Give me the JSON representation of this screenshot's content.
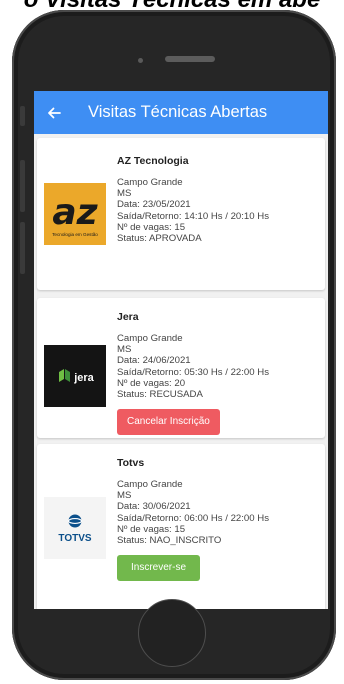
{
  "caption": "o Visitas Técnicas em abe",
  "header": {
    "title": "Visitas Técnicas Abertas",
    "back_icon": "arrow-left-icon",
    "color": "#3e8ef3"
  },
  "visits": [
    {
      "company": "AZ Tecnologia",
      "logo_icon": "az-tecnologia-logo",
      "logo_text": "az",
      "logo_subtext": "Tecnologia em Gestão",
      "city": "Campo Grande",
      "state": "MS",
      "date": "Data: 23/05/2021",
      "times": "Saída/Retorno: 14:10 Hs / 20:10 Hs",
      "vacancies": "Nº de vagas: 15",
      "status": "Status: APROVADA"
    },
    {
      "company": "Jera",
      "logo_icon": "jera-logo",
      "logo_text": "jera",
      "city": "Campo Grande",
      "state": "MS",
      "date": "Data: 24/06/2021",
      "times": "Saída/Retorno: 05:30 Hs / 22:00 Hs",
      "vacancies": "Nº de vagas: 20",
      "status": "Status: RECUSADA",
      "action": "Cancelar Inscrição",
      "action_color": "#ef5b61"
    },
    {
      "company": "Totvs",
      "logo_icon": "totvs-logo",
      "logo_text": "TOTVS",
      "city": "Campo Grande",
      "state": "MS",
      "date": "Data: 30/06/2021",
      "times": "Saída/Retorno: 06:00 Hs / 22:00 Hs",
      "vacancies": "Nº de vagas: 15",
      "status": "Status: NAO_INSCRITO",
      "action": "Inscrever-se",
      "action_color": "#72b84c"
    }
  ]
}
